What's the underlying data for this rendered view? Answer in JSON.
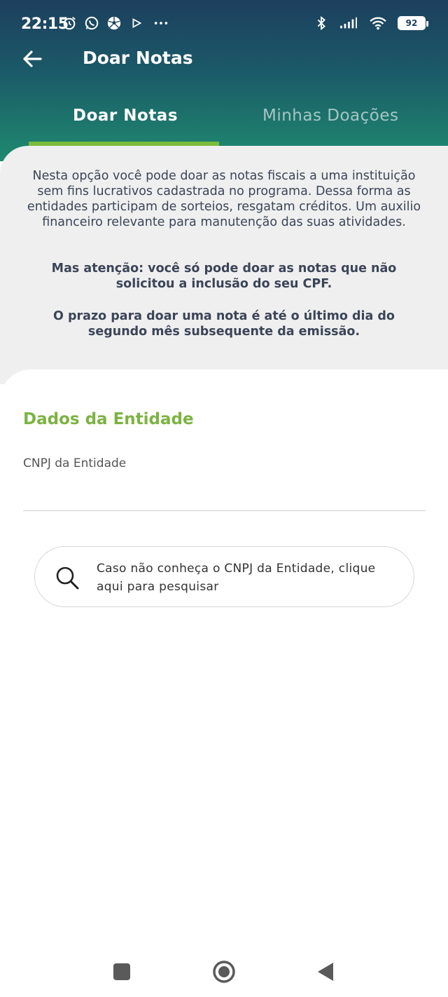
{
  "status_bar": {
    "time": "22:15",
    "battery": "92",
    "left_icons": [
      "alarm-icon",
      "whatsapp-icon",
      "soccer-ball-icon",
      "play-store-icon",
      "more-dots-icon"
    ],
    "right_icons": [
      "bluetooth-icon",
      "signal-icon",
      "wifi-icon",
      "battery-icon"
    ]
  },
  "app_bar": {
    "title": "Doar Notas",
    "back_icon": "arrow-left-icon"
  },
  "tabs": [
    {
      "label": "Doar Notas",
      "selected": true
    },
    {
      "label": "Minhas Doações",
      "selected": false
    }
  ],
  "info": {
    "paragraph_1": "Nesta opção você pode doar as notas fiscais a uma instituição sem fins lucrativos cadastrada no programa. Dessa forma as entidades participam de sorteios, resgatam créditos. Um auxilio financeiro relevante para manutenção das suas atividades.",
    "paragraph_2": "Mas atenção: você só pode doar as notas que não solicitou a inclusão do seu CPF.",
    "paragraph_3": "O prazo para doar uma nota é até o último dia do segundo mês subsequente da emissão."
  },
  "form": {
    "section_title": "Dados da Entidade",
    "cnpj_label": "CNPJ da Entidade",
    "cnpj_value": "",
    "search_hint": "Caso não conheça o CNPJ da Entidade, clique aqui para pesquisar"
  },
  "nav_bar": {
    "buttons": [
      "recent-apps-icon",
      "home-icon",
      "back-icon"
    ]
  },
  "colors": {
    "header_top": "#1d3f5e",
    "header_bottom": "#1f8a6f",
    "accent_green": "#7cb342",
    "tab_indicator": "#7cbc3d",
    "info_background": "#efefef",
    "text_dark": "#3b4558"
  }
}
